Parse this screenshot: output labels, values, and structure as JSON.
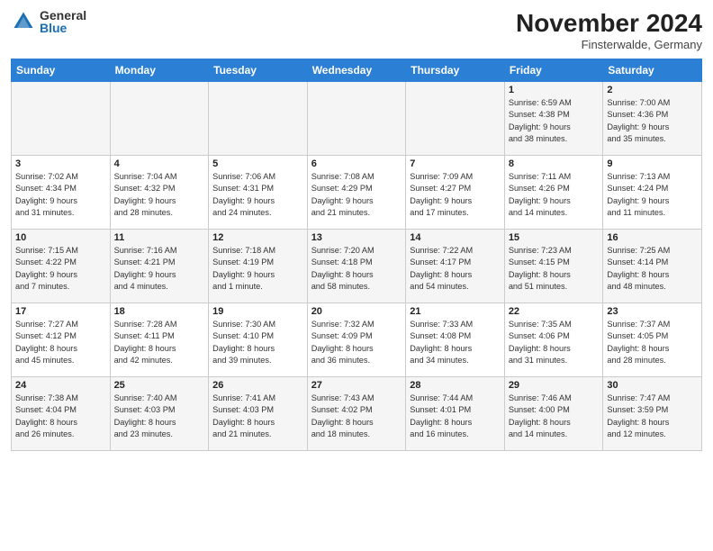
{
  "logo": {
    "general": "General",
    "blue": "Blue"
  },
  "title": "November 2024",
  "location": "Finsterwalde, Germany",
  "headers": [
    "Sunday",
    "Monday",
    "Tuesday",
    "Wednesday",
    "Thursday",
    "Friday",
    "Saturday"
  ],
  "weeks": [
    [
      {
        "day": "",
        "info": ""
      },
      {
        "day": "",
        "info": ""
      },
      {
        "day": "",
        "info": ""
      },
      {
        "day": "",
        "info": ""
      },
      {
        "day": "",
        "info": ""
      },
      {
        "day": "1",
        "info": "Sunrise: 6:59 AM\nSunset: 4:38 PM\nDaylight: 9 hours\nand 38 minutes."
      },
      {
        "day": "2",
        "info": "Sunrise: 7:00 AM\nSunset: 4:36 PM\nDaylight: 9 hours\nand 35 minutes."
      }
    ],
    [
      {
        "day": "3",
        "info": "Sunrise: 7:02 AM\nSunset: 4:34 PM\nDaylight: 9 hours\nand 31 minutes."
      },
      {
        "day": "4",
        "info": "Sunrise: 7:04 AM\nSunset: 4:32 PM\nDaylight: 9 hours\nand 28 minutes."
      },
      {
        "day": "5",
        "info": "Sunrise: 7:06 AM\nSunset: 4:31 PM\nDaylight: 9 hours\nand 24 minutes."
      },
      {
        "day": "6",
        "info": "Sunrise: 7:08 AM\nSunset: 4:29 PM\nDaylight: 9 hours\nand 21 minutes."
      },
      {
        "day": "7",
        "info": "Sunrise: 7:09 AM\nSunset: 4:27 PM\nDaylight: 9 hours\nand 17 minutes."
      },
      {
        "day": "8",
        "info": "Sunrise: 7:11 AM\nSunset: 4:26 PM\nDaylight: 9 hours\nand 14 minutes."
      },
      {
        "day": "9",
        "info": "Sunrise: 7:13 AM\nSunset: 4:24 PM\nDaylight: 9 hours\nand 11 minutes."
      }
    ],
    [
      {
        "day": "10",
        "info": "Sunrise: 7:15 AM\nSunset: 4:22 PM\nDaylight: 9 hours\nand 7 minutes."
      },
      {
        "day": "11",
        "info": "Sunrise: 7:16 AM\nSunset: 4:21 PM\nDaylight: 9 hours\nand 4 minutes."
      },
      {
        "day": "12",
        "info": "Sunrise: 7:18 AM\nSunset: 4:19 PM\nDaylight: 9 hours\nand 1 minute."
      },
      {
        "day": "13",
        "info": "Sunrise: 7:20 AM\nSunset: 4:18 PM\nDaylight: 8 hours\nand 58 minutes."
      },
      {
        "day": "14",
        "info": "Sunrise: 7:22 AM\nSunset: 4:17 PM\nDaylight: 8 hours\nand 54 minutes."
      },
      {
        "day": "15",
        "info": "Sunrise: 7:23 AM\nSunset: 4:15 PM\nDaylight: 8 hours\nand 51 minutes."
      },
      {
        "day": "16",
        "info": "Sunrise: 7:25 AM\nSunset: 4:14 PM\nDaylight: 8 hours\nand 48 minutes."
      }
    ],
    [
      {
        "day": "17",
        "info": "Sunrise: 7:27 AM\nSunset: 4:12 PM\nDaylight: 8 hours\nand 45 minutes."
      },
      {
        "day": "18",
        "info": "Sunrise: 7:28 AM\nSunset: 4:11 PM\nDaylight: 8 hours\nand 42 minutes."
      },
      {
        "day": "19",
        "info": "Sunrise: 7:30 AM\nSunset: 4:10 PM\nDaylight: 8 hours\nand 39 minutes."
      },
      {
        "day": "20",
        "info": "Sunrise: 7:32 AM\nSunset: 4:09 PM\nDaylight: 8 hours\nand 36 minutes."
      },
      {
        "day": "21",
        "info": "Sunrise: 7:33 AM\nSunset: 4:08 PM\nDaylight: 8 hours\nand 34 minutes."
      },
      {
        "day": "22",
        "info": "Sunrise: 7:35 AM\nSunset: 4:06 PM\nDaylight: 8 hours\nand 31 minutes."
      },
      {
        "day": "23",
        "info": "Sunrise: 7:37 AM\nSunset: 4:05 PM\nDaylight: 8 hours\nand 28 minutes."
      }
    ],
    [
      {
        "day": "24",
        "info": "Sunrise: 7:38 AM\nSunset: 4:04 PM\nDaylight: 8 hours\nand 26 minutes."
      },
      {
        "day": "25",
        "info": "Sunrise: 7:40 AM\nSunset: 4:03 PM\nDaylight: 8 hours\nand 23 minutes."
      },
      {
        "day": "26",
        "info": "Sunrise: 7:41 AM\nSunset: 4:03 PM\nDaylight: 8 hours\nand 21 minutes."
      },
      {
        "day": "27",
        "info": "Sunrise: 7:43 AM\nSunset: 4:02 PM\nDaylight: 8 hours\nand 18 minutes."
      },
      {
        "day": "28",
        "info": "Sunrise: 7:44 AM\nSunset: 4:01 PM\nDaylight: 8 hours\nand 16 minutes."
      },
      {
        "day": "29",
        "info": "Sunrise: 7:46 AM\nSunset: 4:00 PM\nDaylight: 8 hours\nand 14 minutes."
      },
      {
        "day": "30",
        "info": "Sunrise: 7:47 AM\nSunset: 3:59 PM\nDaylight: 8 hours\nand 12 minutes."
      }
    ]
  ]
}
